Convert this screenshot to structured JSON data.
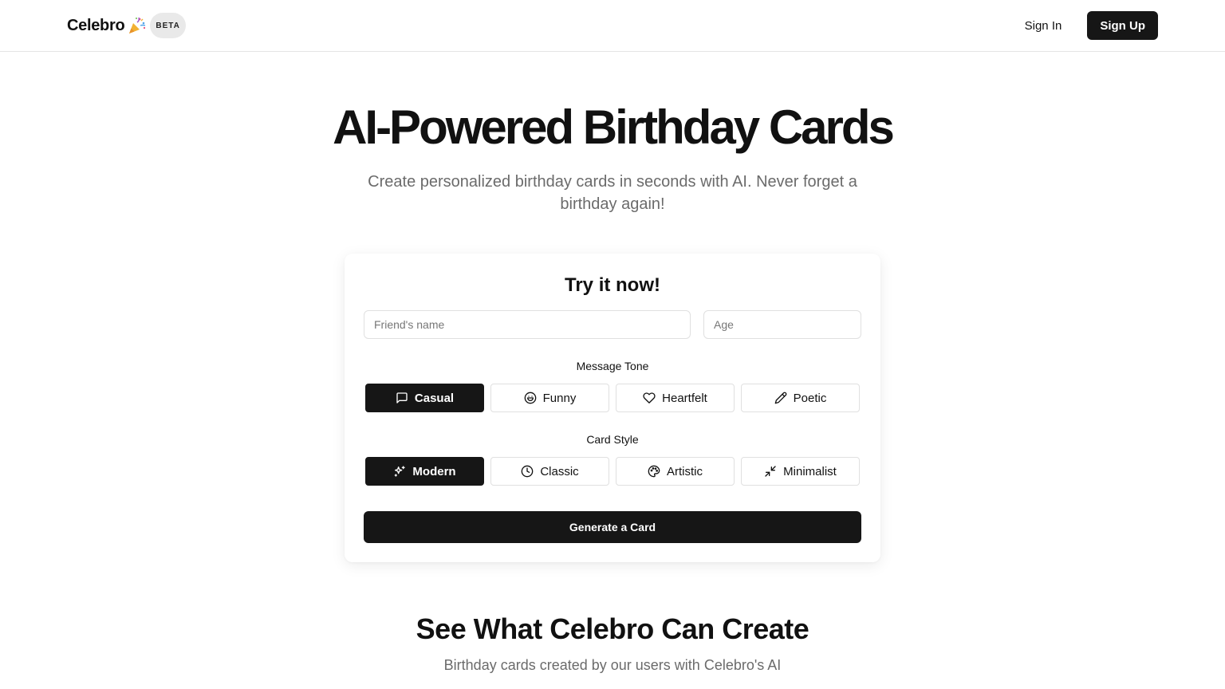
{
  "header": {
    "brand_name": "Celebro",
    "brand_icon": "party-popper-emoji",
    "beta_badge": "BETA",
    "sign_in_label": "Sign In",
    "sign_up_label": "Sign Up"
  },
  "hero": {
    "title": "AI-Powered Birthday Cards",
    "subtitle": "Create personalized birthday cards in seconds with AI. Never forget a birthday again!"
  },
  "form": {
    "title": "Try it now!",
    "name_placeholder": "Friend's name",
    "name_value": "",
    "age_placeholder": "Age",
    "age_value": "",
    "tone_label": "Message Tone",
    "tones": [
      {
        "label": "Casual",
        "icon": "message-square-icon",
        "selected": true
      },
      {
        "label": "Funny",
        "icon": "smile-icon",
        "selected": false
      },
      {
        "label": "Heartfelt",
        "icon": "heart-icon",
        "selected": false
      },
      {
        "label": "Poetic",
        "icon": "pencil-icon",
        "selected": false
      }
    ],
    "style_label": "Card Style",
    "styles": [
      {
        "label": "Modern",
        "icon": "sparkles-icon",
        "selected": true
      },
      {
        "label": "Classic",
        "icon": "clock-icon",
        "selected": false
      },
      {
        "label": "Artistic",
        "icon": "palette-icon",
        "selected": false
      },
      {
        "label": "Minimalist",
        "icon": "minimize-icon",
        "selected": false
      }
    ],
    "generate_label": "Generate a Card"
  },
  "showcase": {
    "title": "See What Celebro Can Create",
    "subtitle": "Birthday cards created by our users with Celebro's AI"
  },
  "colors": {
    "primary": "#161616",
    "muted_text": "#6b6b6b",
    "border": "#e0e0e0",
    "badge_bg": "#e9e9e9"
  }
}
